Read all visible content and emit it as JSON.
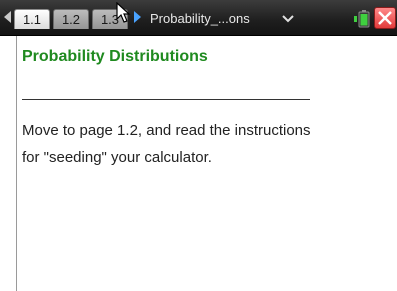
{
  "tabs": [
    {
      "label": "1.1",
      "active": true
    },
    {
      "label": "1.2",
      "active": false
    },
    {
      "label": "1.3",
      "active": false
    }
  ],
  "document": {
    "title": "Probability_...ons"
  },
  "page": {
    "heading": "Probability Distributions",
    "instructions_line1": "Move to page 1.2, and read the instructions",
    "instructions_line2": "for \"seeding\" your calculator."
  },
  "colors": {
    "heading": "#1f8a1f",
    "active_tab": "#ffffff",
    "inactive_tab": "#a8a8a8",
    "bar": "#1e1e1e",
    "close": "#e23b3b"
  },
  "icons": [
    "nav-left-icon",
    "nav-right-icon",
    "dropdown-icon",
    "battery-icon",
    "close-icon",
    "cursor-icon"
  ]
}
